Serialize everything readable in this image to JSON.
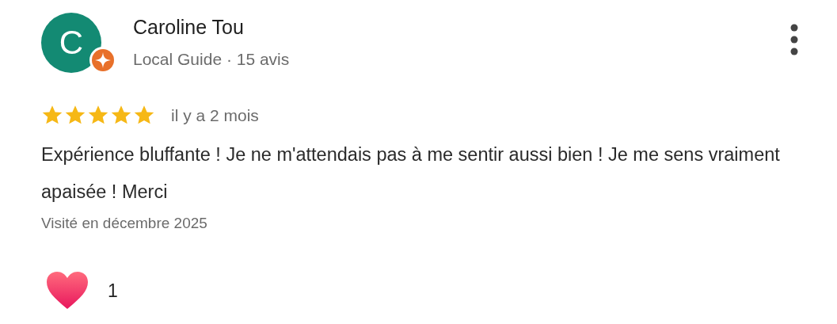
{
  "review": {
    "avatar_letter": "C",
    "author": "Caroline Tou",
    "author_meta": "Local Guide · 15 avis",
    "stars": 5,
    "time": "il y a 2 mois",
    "text": "Expérience bluffante ! Je ne m'attendais pas à me sentir aussi bien ! Je me sens vraiment apaisée ! Merci",
    "visited": "Visité en décembre 2025",
    "reaction_count": "1"
  }
}
